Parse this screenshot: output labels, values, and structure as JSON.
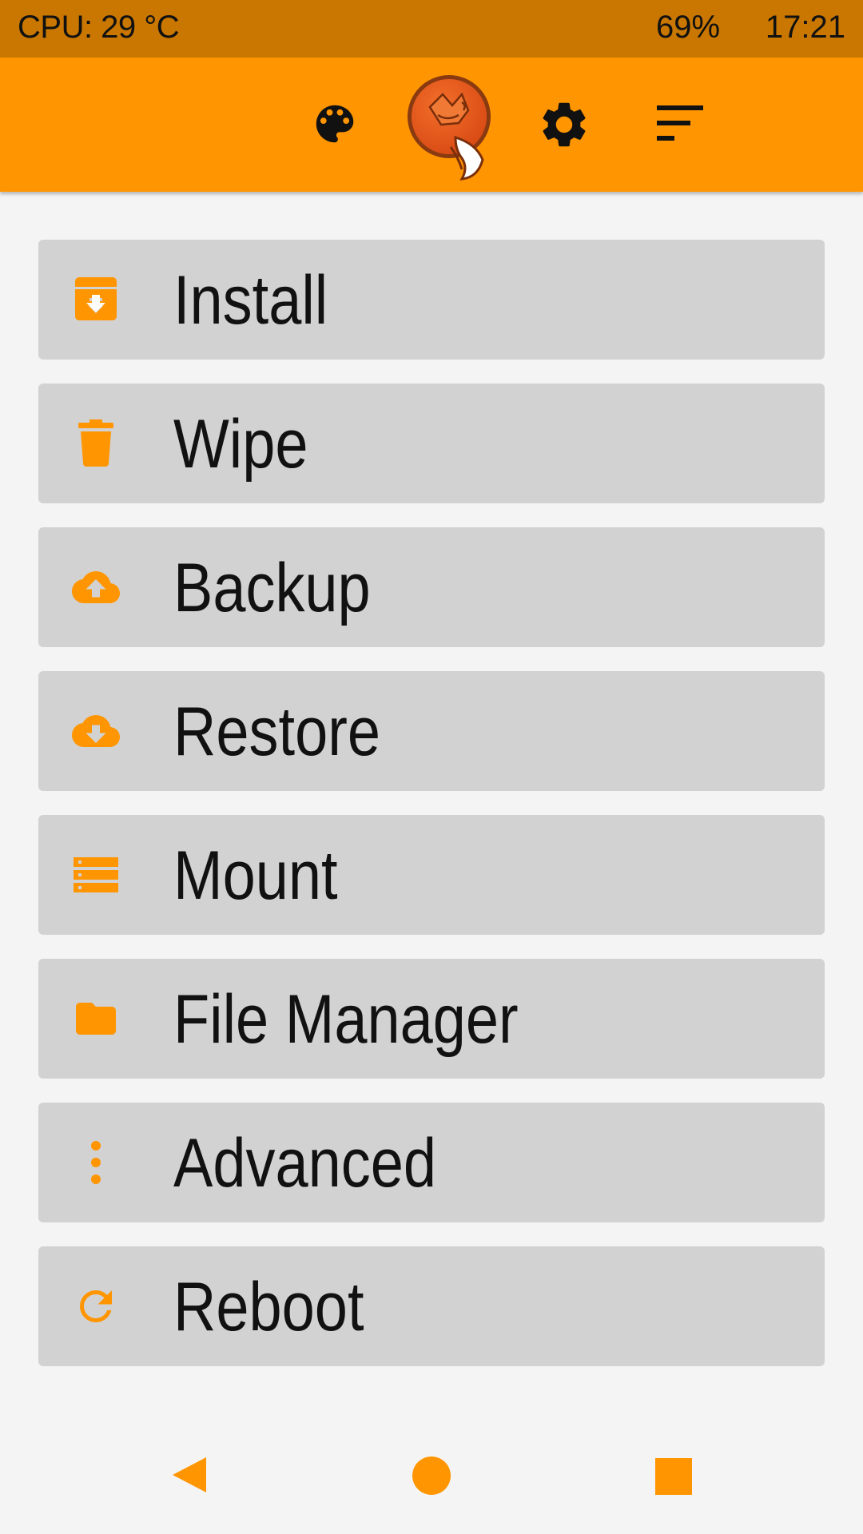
{
  "status_bar": {
    "cpu_temp": "CPU: 29 °C",
    "battery": "69%",
    "time": "17:21"
  },
  "toolbar": {
    "icons": [
      "palette-icon",
      "fox-logo-icon",
      "gear-icon",
      "sort-icon"
    ],
    "accent_color": "#ff9500"
  },
  "menu": {
    "items": [
      {
        "label": "Install",
        "icon": "archive-download-icon"
      },
      {
        "label": "Wipe",
        "icon": "trash-icon"
      },
      {
        "label": "Backup",
        "icon": "cloud-upload-icon"
      },
      {
        "label": "Restore",
        "icon": "cloud-download-icon"
      },
      {
        "label": "Mount",
        "icon": "storage-icon"
      },
      {
        "label": "File Manager",
        "icon": "folder-icon"
      },
      {
        "label": "Advanced",
        "icon": "more-vertical-icon"
      },
      {
        "label": "Reboot",
        "icon": "refresh-icon"
      }
    ],
    "icon_color": "#ff9500",
    "item_background": "#d2d2d2"
  },
  "nav_bar": {
    "icons": [
      "back-icon",
      "home-icon",
      "recents-icon"
    ],
    "color": "#ff9500"
  }
}
